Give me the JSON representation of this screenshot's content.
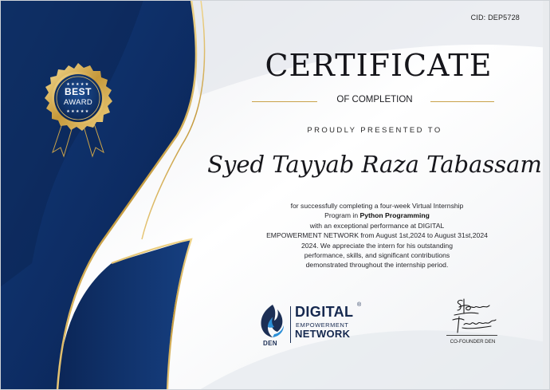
{
  "certificate": {
    "cid": "CID: DEP5728",
    "title": "CERTIFICATE",
    "subtitle": "OF COMPLETION",
    "presented_label": "PROUDLY PRESENTED TO",
    "recipient_name": "Syed Tayyab Raza Tabassam",
    "body_line_1": "for successfully completing a four-week Virtual Internship",
    "body_line_2_prefix": "Program in ",
    "body_line_2_bold": "Python Programming",
    "body_line_3": "with an exceptional performance at DIGITAL",
    "body_line_4": "EMPOWERMENT NETWORK from August 1st,2024 to August 31st,2024",
    "body_line_5": "2024. We appreciate the intern for his outstanding",
    "body_line_6": "performance, skills, and significant contributions",
    "body_line_7": "demonstrated throughout the internship period."
  },
  "badge": {
    "stars": "★★★★★",
    "line1": "BEST",
    "line2": "AWARD"
  },
  "logo": {
    "short": "DEN",
    "line1": "DIGITAL",
    "registered": "®",
    "line2": "EMPOWERMENT",
    "line3": "NETWORK"
  },
  "signature": {
    "caption": "CO-FOUNDER DEN",
    "signed_text": "Tayyab Tabassum"
  },
  "colors": {
    "navy": "#0f2a5c",
    "gold": "#c9a24a",
    "text": "#15151a"
  }
}
